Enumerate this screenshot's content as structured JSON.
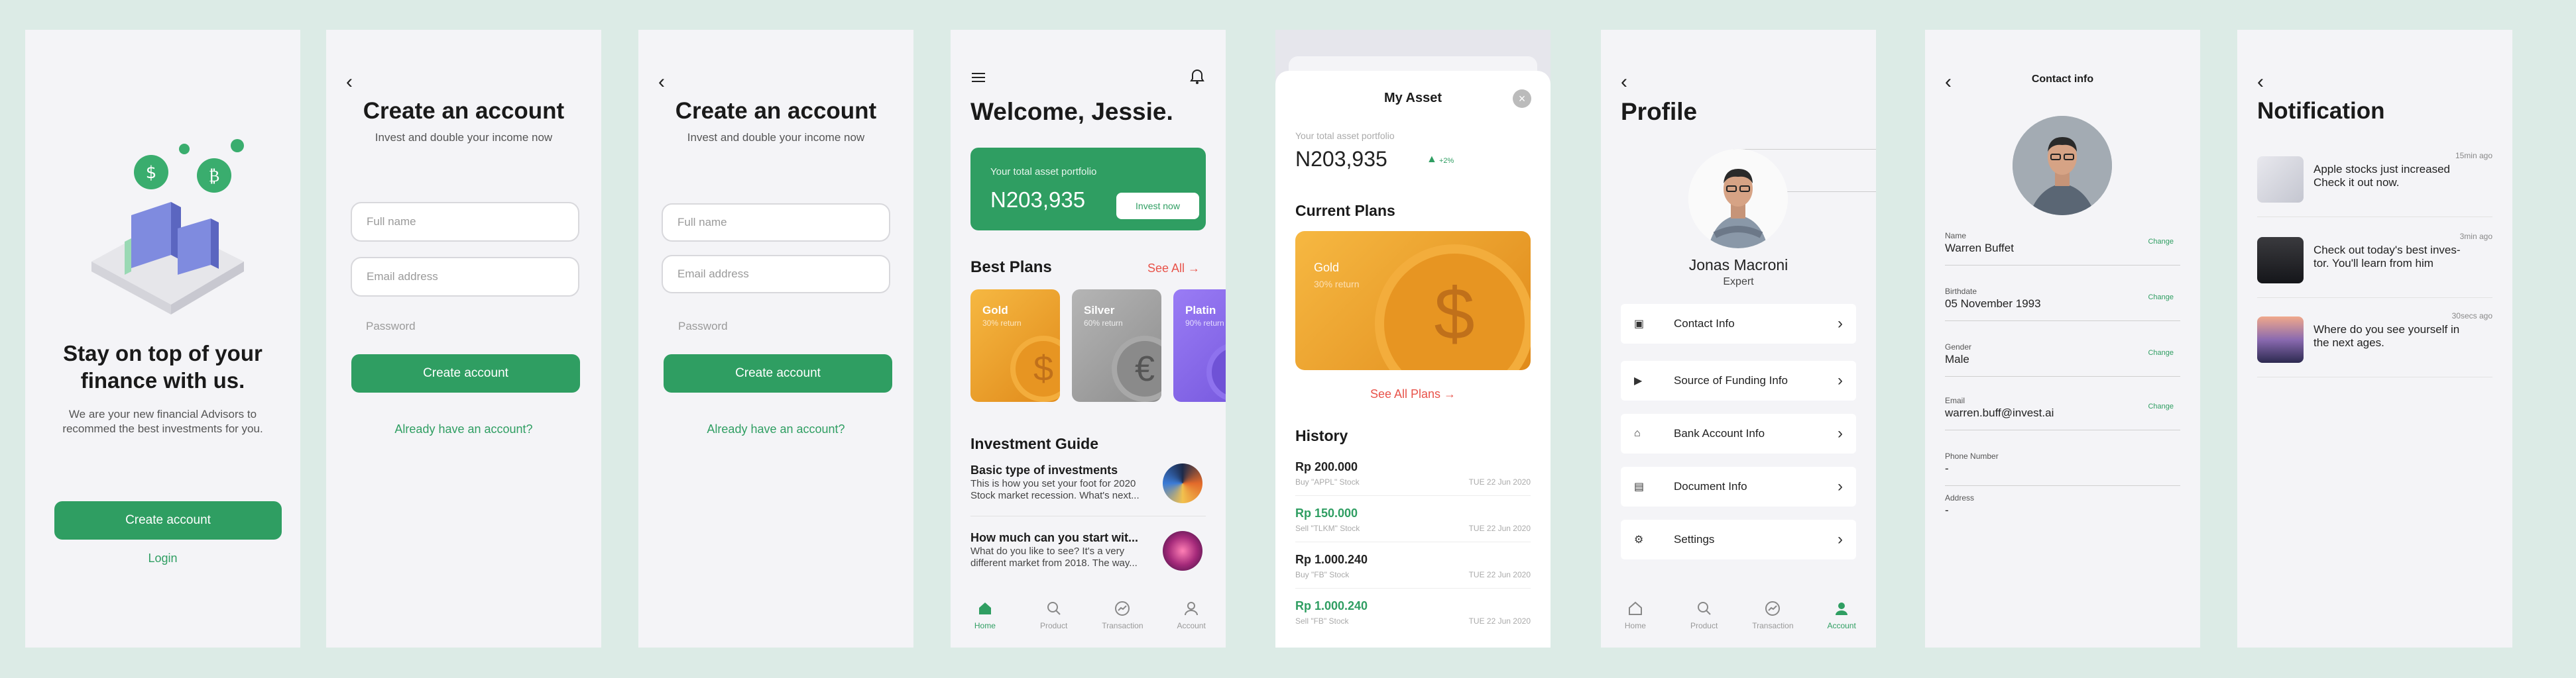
{
  "onboarding": {
    "title": "Stay on top of your finance with us.",
    "subtitle": "We are your new financial Advisors to recommed the best investments for you.",
    "create_button": "Create account",
    "login_link": "Login"
  },
  "signup": {
    "title": "Create an account",
    "subtitle": "Invest and double your income now",
    "fullname_placeholder": "Full name",
    "email_placeholder": "Email address",
    "password_placeholder": "Password",
    "create_button": "Create account",
    "login_link": "Already have an account?"
  },
  "home": {
    "welcome": "Welcome, Jessie.",
    "portfolio_label": "Your total asset portfolio",
    "portfolio_value": "N203,935",
    "invest_button": "Invest now",
    "best_plans": "Best Plans",
    "see_all": "See All →",
    "plans": [
      {
        "name": "Gold",
        "ret": "30% return"
      },
      {
        "name": "Silver",
        "ret": "60% return"
      },
      {
        "name": "Platin",
        "ret": "90% return"
      }
    ],
    "guide_title": "Investment Guide",
    "guides": [
      {
        "title": "Basic type of investments",
        "body": "This is how you set your foot for 2020 Stock market recession. What's next..."
      },
      {
        "title": "How much can you start wit...",
        "body": "What do you like to see? It's a very different market from 2018. The way..."
      }
    ]
  },
  "tabs": {
    "home": "Home",
    "product": "Product",
    "transaction": "Transaction",
    "account": "Account"
  },
  "asset": {
    "title": "My Asset",
    "portfolio_label": "Your total asset portfolio",
    "portfolio_value": "N203,935",
    "change": "+2%",
    "current_plans": "Current Plans",
    "plan_name": "Gold",
    "plan_return": "30% return",
    "see_all": "See All Plans →",
    "history_title": "History",
    "history": [
      {
        "amount": "Rp 200.000",
        "desc": "Buy \"APPL\" Stock",
        "date": "TUE 22 Jun 2020"
      },
      {
        "amount": "Rp 150.000",
        "desc": "Sell \"TLKM\" Stock",
        "date": "TUE 22 Jun 2020"
      },
      {
        "amount": "Rp 1.000.240",
        "desc": "Buy \"FB\" Stock",
        "date": "TUE 22 Jun 2020"
      },
      {
        "amount": "Rp 1.000.240",
        "desc": "Sell \"FB\" Stock",
        "date": "TUE 22 Jun 2020"
      }
    ]
  },
  "profile": {
    "title": "Profile",
    "name": "Jonas Macroni",
    "role": "Expert",
    "menu": [
      "Contact Info",
      "Source of Funding Info",
      "Bank Account Info",
      "Document Info",
      "Settings"
    ]
  },
  "contact": {
    "title": "Contact info",
    "change": "Change",
    "fields": [
      {
        "label": "Name",
        "value": "Warren Buffet"
      },
      {
        "label": "Birthdate",
        "value": "05 November 1993"
      },
      {
        "label": "Gender",
        "value": "Male"
      },
      {
        "label": "Email",
        "value": "warren.buff@invest.ai"
      },
      {
        "label": "Phone Number",
        "value": "-"
      },
      {
        "label": "Address",
        "value": "-"
      }
    ]
  },
  "notification": {
    "title": "Notification",
    "items": [
      {
        "text": "Apple stocks just increased Check it out now.",
        "time": "15min ago"
      },
      {
        "text": "Check out today's best inves-tor. You'll learn from him",
        "time": "3min ago"
      },
      {
        "text": "Where do you see yourself in the next ages.",
        "time": "30secs ago"
      }
    ]
  },
  "colors": {
    "accent": "#2f9e62",
    "link": "#e8534a",
    "gold": "#f0a030",
    "silver": "#9a9a9a",
    "platinum": "#8a6cf0"
  }
}
